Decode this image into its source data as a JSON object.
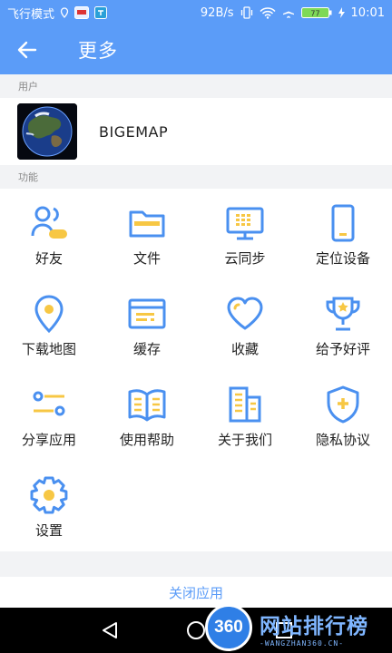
{
  "statusbar": {
    "mode": "飞行模式",
    "speed": "92B/s",
    "battery": "77",
    "time": "10:01"
  },
  "appbar": {
    "title": "更多"
  },
  "sections": {
    "user": "用户",
    "features": "功能"
  },
  "user": {
    "name": "BIGEMAP"
  },
  "features": [
    {
      "label": "好友",
      "icon": "friends-icon"
    },
    {
      "label": "文件",
      "icon": "folder-icon"
    },
    {
      "label": "云同步",
      "icon": "cloud-sync-icon"
    },
    {
      "label": "定位设备",
      "icon": "device-icon"
    },
    {
      "label": "下载地图",
      "icon": "location-pin-icon"
    },
    {
      "label": "缓存",
      "icon": "cache-icon"
    },
    {
      "label": "收藏",
      "icon": "heart-icon"
    },
    {
      "label": "给予好评",
      "icon": "trophy-icon"
    },
    {
      "label": "分享应用",
      "icon": "share-icon"
    },
    {
      "label": "使用帮助",
      "icon": "book-icon"
    },
    {
      "label": "关于我们",
      "icon": "building-icon"
    },
    {
      "label": "隐私协议",
      "icon": "shield-icon"
    },
    {
      "label": "设置",
      "icon": "gear-icon"
    }
  ],
  "footer": {
    "close_label": "关闭应用"
  },
  "watermark": {
    "badge": "360",
    "main": "网站排行榜",
    "sub": "-WANGZHAN360.CN-"
  },
  "colors": {
    "primary": "#5b9cf8",
    "icon_blue": "#4a90f0",
    "icon_yellow": "#f7c744"
  }
}
